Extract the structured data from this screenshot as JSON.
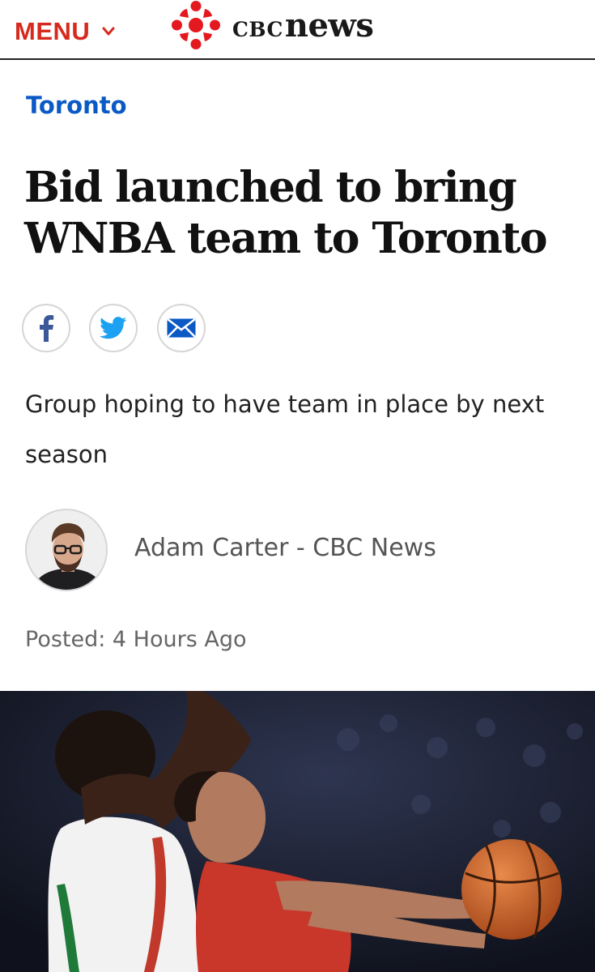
{
  "header": {
    "menu_label": "MENU",
    "brand_cbc": "CBC",
    "brand_news": "news",
    "brand_color": "#d62a1d"
  },
  "article": {
    "section": "Toronto",
    "headline_line1": "Bid launched to bring",
    "headline_line2": "WNBA team to Toronto",
    "deck": "Group hoping to have team in place by next season",
    "byline": "Adam Carter - CBC News",
    "posted": "Posted: 4 Hours Ago"
  },
  "share": {
    "icons": [
      "facebook-icon",
      "twitter-icon",
      "email-icon"
    ],
    "facebook_color": "#3b5998",
    "twitter_color": "#1da1f2",
    "email_color": "#0a59c5"
  },
  "colors": {
    "link": "#0a59c5",
    "text": "#111111"
  }
}
